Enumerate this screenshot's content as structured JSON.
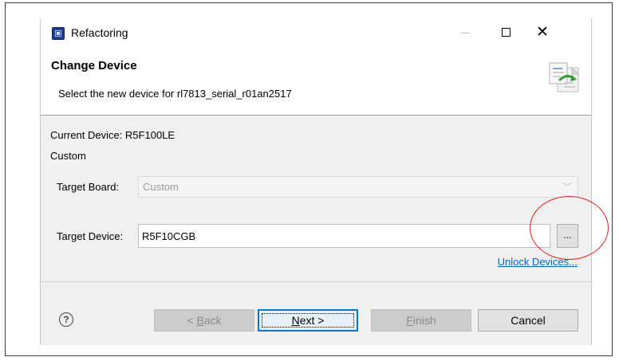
{
  "window": {
    "title": "Refactoring",
    "controls": {
      "close_glyph": "✕"
    }
  },
  "header": {
    "title": "Change Device",
    "description": "Select the new device for rl7813_serial_r01an2517"
  },
  "content": {
    "current_device_label": "Current Device: R5F100LE",
    "current_board_label": "Custom",
    "target_board": {
      "label": "Target Board:",
      "value": "Custom",
      "dropdown_glyph": "﹀"
    },
    "target_device": {
      "label": "Target Device:",
      "value": "R5F10CGB"
    },
    "browse_button": "...",
    "unlock_link": "Unlock Devices..."
  },
  "footer": {
    "help_glyph": "?",
    "back_prefix": "< ",
    "back_mnemonic": "B",
    "back_rest": "ack",
    "next_mnemonic": "N",
    "next_suffix": "ext >",
    "finish_mnemonic": "F",
    "finish_rest": "inish",
    "cancel": "Cancel"
  },
  "icons": {
    "app": "renesas-app-icon",
    "wizard": "refactoring-wizard-icon",
    "help": "help-icon",
    "minimize": "minimize-icon",
    "maximize": "maximize-icon",
    "close": "close-icon"
  },
  "annotation": {
    "color": "#e02020"
  }
}
